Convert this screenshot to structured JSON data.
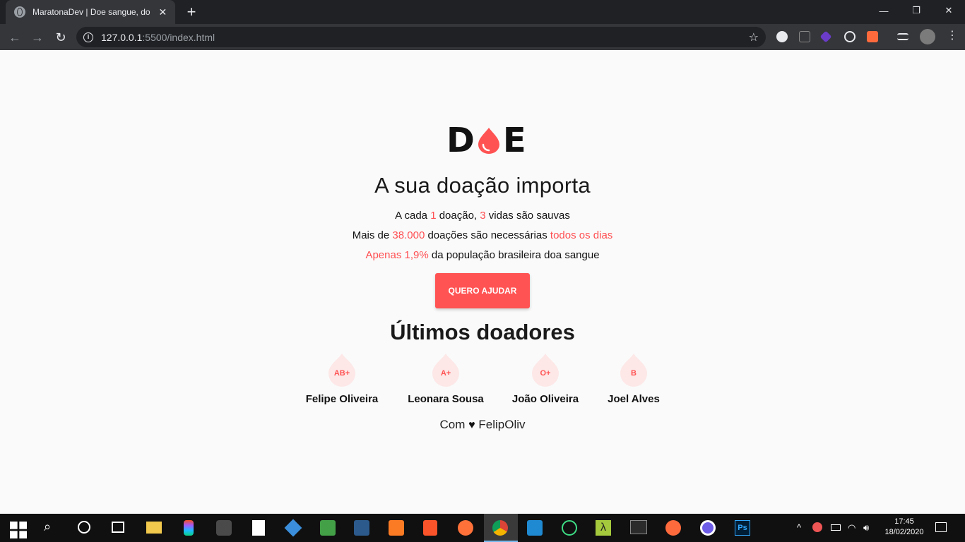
{
  "browser": {
    "tab_title": "MaratonaDev | Doe sangue, doe",
    "url_host": "127.0.0.1",
    "url_rest": ":5500/index.html"
  },
  "page": {
    "logo": {
      "left": "D",
      "right": "E"
    },
    "headline": "A sua doação importa",
    "facts": [
      {
        "parts": [
          [
            "A cada ",
            false
          ],
          [
            "1",
            true
          ],
          [
            " doação, ",
            false
          ],
          [
            "3",
            true
          ],
          [
            " vidas são sauvas",
            false
          ]
        ]
      },
      {
        "parts": [
          [
            "Mais de ",
            false
          ],
          [
            "38.000",
            true
          ],
          [
            " doações são necessárias ",
            false
          ],
          [
            "todos os dias",
            true
          ]
        ]
      },
      {
        "parts": [
          [
            "Apenas 1,9%",
            true
          ],
          [
            " da população brasileira doa sangue",
            false
          ]
        ]
      }
    ],
    "cta_label": "QUERO AJUDAR",
    "donors_title": "Últimos doadores",
    "donors": [
      {
        "blood": "AB+",
        "name": "Felipe Oliveira"
      },
      {
        "blood": "A+",
        "name": "Leonara Sousa"
      },
      {
        "blood": "O+",
        "name": "João Oliveira"
      },
      {
        "blood": "B",
        "name": "Joel Alves"
      }
    ],
    "footer_prefix": "Com",
    "footer_suffix": "FelipOliv",
    "accent_color": "#ff5353"
  },
  "taskbar": {
    "time": "17:45",
    "date": "18/02/2020"
  }
}
